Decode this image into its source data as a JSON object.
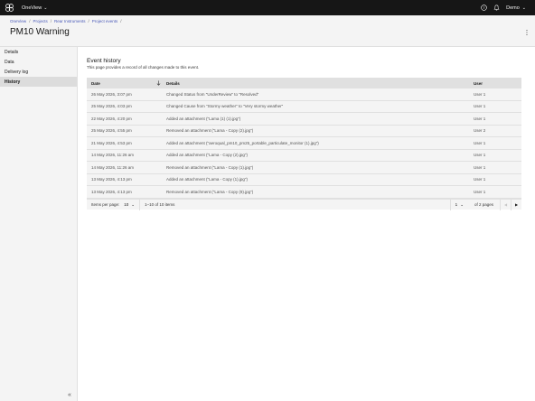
{
  "topbar": {
    "app_name": "OneView",
    "user_name": "Demo",
    "icons": [
      "app-logo-icon",
      "help-icon",
      "notification-icon"
    ]
  },
  "breadcrumb": [
    "OneView",
    "Projects",
    "Rear Instruments",
    "Project events"
  ],
  "page_title": "PM10 Warning",
  "sidebar": {
    "items": [
      {
        "label": "Details",
        "active": false
      },
      {
        "label": "Data",
        "active": false
      },
      {
        "label": "Delivery log",
        "active": false
      },
      {
        "label": "History",
        "active": true
      }
    ],
    "collapse_glyph": "«"
  },
  "main": {
    "title": "Event history",
    "description": "This page provides a record of all changes made to this event.",
    "table": {
      "headers": {
        "date": "Date",
        "details": "Details",
        "user": "User"
      },
      "rows": [
        {
          "date": "26 May 2026, 3:07 pm",
          "details": "Changed Status from \"UnderReview\" to \"Resolved\"",
          "user": "User 1"
        },
        {
          "date": "25 May 2026, 4:03 pm",
          "details": "Changed Cause from \"Stormy weather\" to \"Very stormy weather\"",
          "user": "User 1"
        },
        {
          "date": "22 May 2026, 4:20 pm",
          "details": "Added an attachment (\"Lama (1) (1).jpg\")",
          "user": "User 1"
        },
        {
          "date": "25 May 2026, 4:55 pm",
          "details": "Removed an attachment (\"Lama - Copy (2).jpg\")",
          "user": "User 2"
        },
        {
          "date": "21 May 2026, 4:53 pm",
          "details": "Added an attachment (\"aeroqual_pm10_pm25_portable_particulate_monitor (1).jpg\")",
          "user": "User 1"
        },
        {
          "date": "14 May 2026, 11:26 am",
          "details": "Added an attachment (\"Lama - Copy (2).jpg\")",
          "user": "User 1"
        },
        {
          "date": "14 May 2026, 11:26 am",
          "details": "Removed an attachment (\"Lama - Copy (1).jpg\")",
          "user": "User 1"
        },
        {
          "date": "13 May 2026, 4:13 pm",
          "details": "Added an attachment (\"Lama - Copy (1).jpg\")",
          "user": "User 1"
        },
        {
          "date": "13 May 2026, 4:13 pm",
          "details": "Removed an attachment (\"Lama - Copy (9).jpg\")",
          "user": "User 1"
        }
      ]
    },
    "pagination": {
      "items_per_page_label": "Items per page:",
      "items_per_page": "10",
      "range": "1–10 of 10 items",
      "current_page": "1",
      "of_pages": "of 2 pages",
      "prev_glyph": "◀",
      "next_glyph": "▶"
    }
  },
  "colors": {
    "topbar_bg": "#161616",
    "link": "#4a5ab8",
    "surface": "#f4f4f4",
    "header_row": "#e0e0e0",
    "active_nav": "#dcdcdc"
  }
}
